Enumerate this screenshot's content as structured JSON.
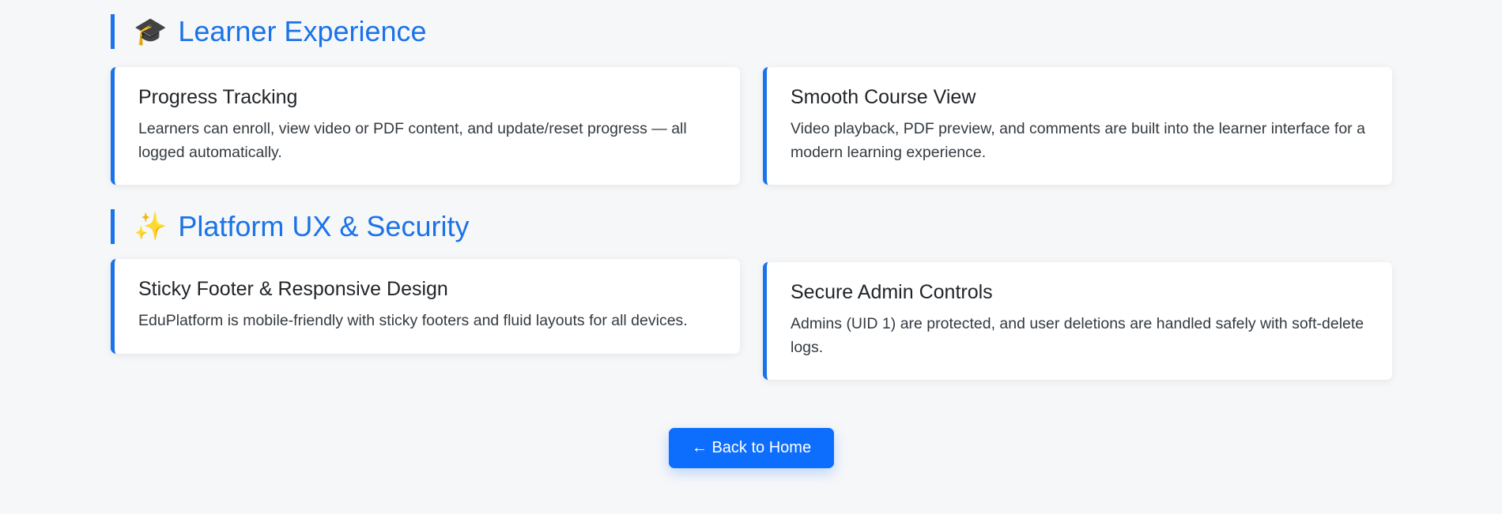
{
  "sections": [
    {
      "icon": "graduation-cap-icon",
      "emoji": "🎓",
      "title": "Learner Experience",
      "cards": [
        {
          "title": "Progress Tracking",
          "text": "Learners can enroll, view video or PDF content, and update/reset progress — all logged automatically."
        },
        {
          "title": "Smooth Course View",
          "text": "Video playback, PDF preview, and comments are built into the learner interface for a modern learning experience."
        }
      ]
    },
    {
      "icon": "sparkles-icon",
      "emoji": "✨",
      "title": "Platform UX & Security",
      "cards": [
        {
          "title": "Sticky Footer & Responsive Design",
          "text": "EduPlatform is mobile-friendly with sticky footers and fluid layouts for all devices."
        },
        {
          "title": "Secure Admin Controls",
          "text": "Admins (UID 1) are protected, and user deletions are handled safely with soft-delete logs."
        }
      ]
    }
  ],
  "back_button": {
    "label": "← Back to Home"
  },
  "colors": {
    "accent": "#1a73e8",
    "button": "#0d6efd",
    "background": "#f6f7f9"
  }
}
